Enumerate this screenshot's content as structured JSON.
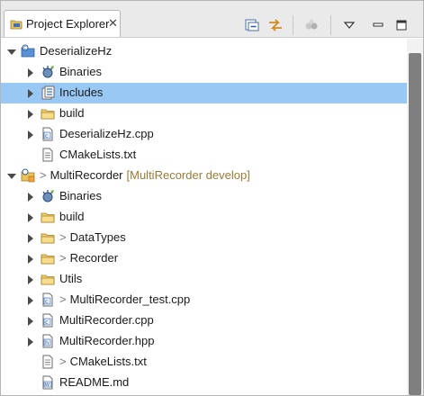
{
  "tab": {
    "title": "Project Explorer",
    "close_glyph": "✕"
  },
  "toolbar": {
    "collapse_all_icon": "collapse-all-icon",
    "link_editor_icon": "link-with-editor-icon",
    "focus_icon": "focus-on-active-task-icon",
    "view_menu_icon": "view-menu-icon",
    "minimize_icon": "minimize-icon",
    "maximize_icon": "maximize-icon"
  },
  "tree": [
    {
      "label": "DeserializeHz",
      "icon": "cproject-icon",
      "twisty": "open",
      "level": 0
    },
    {
      "label": "Binaries",
      "icon": "binaries-icon",
      "twisty": "closed",
      "level": 1
    },
    {
      "label": "Includes",
      "icon": "includes-icon",
      "twisty": "closed",
      "level": 1,
      "selected": true
    },
    {
      "label": "build",
      "icon": "folder-icon",
      "twisty": "closed",
      "level": 1
    },
    {
      "label": "DeserializeHz.cpp",
      "icon": "cpp-file-icon",
      "twisty": "closed",
      "level": 1
    },
    {
      "label": "CMakeLists.txt",
      "icon": "text-file-icon",
      "twisty": "none",
      "level": 1
    },
    {
      "prefix": ">",
      "label": "MultiRecorder",
      "decoration": "[MultiRecorder develop]",
      "icon": "git-cproject-icon",
      "twisty": "open",
      "level": 0
    },
    {
      "label": "Binaries",
      "icon": "binaries-icon",
      "twisty": "closed",
      "level": 1
    },
    {
      "label": "build",
      "icon": "folder-icon",
      "twisty": "closed",
      "level": 1
    },
    {
      "prefix": ">",
      "label": "DataTypes",
      "icon": "folder-icon",
      "twisty": "closed",
      "level": 1
    },
    {
      "prefix": ">",
      "label": "Recorder",
      "icon": "folder-icon",
      "twisty": "closed",
      "level": 1
    },
    {
      "label": "Utils",
      "icon": "folder-icon",
      "twisty": "closed",
      "level": 1
    },
    {
      "prefix": ">",
      "label": "MultiRecorder_test.cpp",
      "icon": "cpp-file-icon",
      "twisty": "closed",
      "level": 1
    },
    {
      "label": "MultiRecorder.cpp",
      "icon": "cpp-file-icon",
      "twisty": "closed",
      "level": 1
    },
    {
      "label": "MultiRecorder.hpp",
      "icon": "hpp-file-icon",
      "twisty": "closed",
      "level": 1
    },
    {
      "prefix": ">",
      "label": "CMakeLists.txt",
      "icon": "text-file-icon",
      "twisty": "none",
      "level": 1
    },
    {
      "label": "README.md",
      "icon": "markdown-file-icon",
      "twisty": "none",
      "level": 1
    }
  ]
}
